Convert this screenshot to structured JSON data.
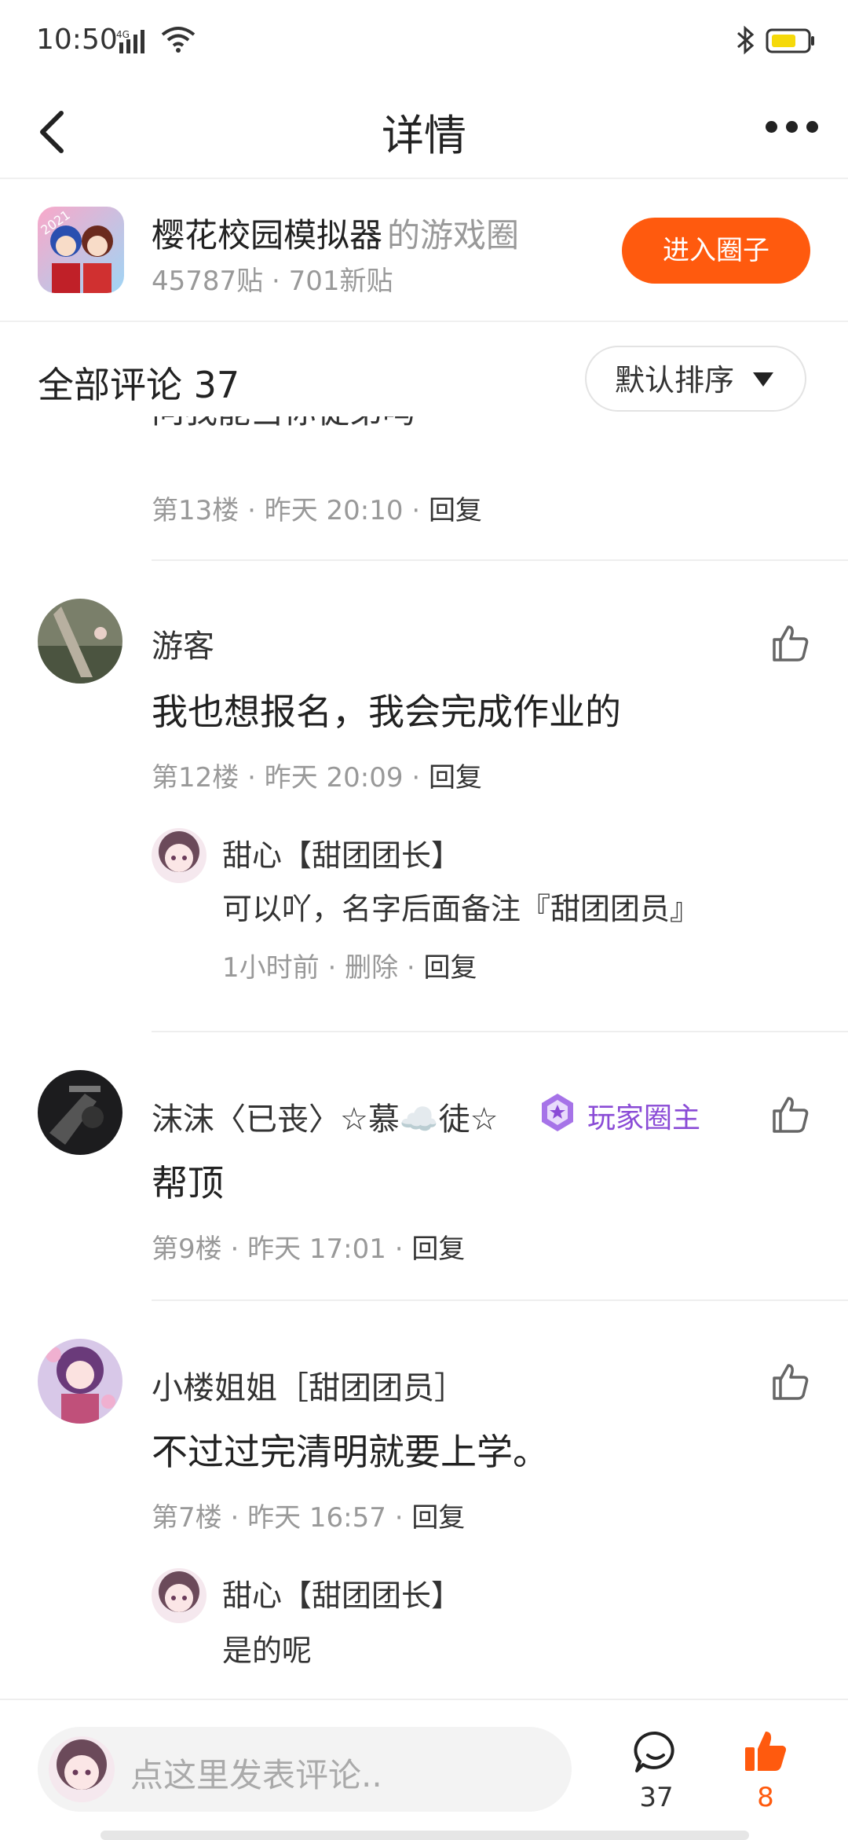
{
  "status_bar": {
    "time": "10:50",
    "network": "4G"
  },
  "header": {
    "title": "详情"
  },
  "circle": {
    "game_name": "樱花校园模拟器",
    "suffix": "的游戏圈",
    "stats": "45787贴 · 701新贴",
    "enter_label": "进入圈子",
    "icon_badge": "2021"
  },
  "comments_header": {
    "title": "全部评论 37",
    "sort_label": "默认排序"
  },
  "partial_comment": {
    "text": "问我能当你徒弟吗",
    "floor": "第13楼",
    "time": "昨天 20:10",
    "reply": "回复"
  },
  "comments": [
    {
      "user": "游客",
      "text": "我也想报名，我会完成作业的",
      "floor": "第12楼",
      "time": "昨天 20:09",
      "reply": "回复",
      "sub": {
        "user": "甜心【甜团团长】",
        "text": "可以吖，名字后面备注『甜团团员』",
        "time": "1小时前",
        "delete": "删除",
        "reply": "回复"
      }
    },
    {
      "user": "沫沫〈已丧〉☆慕☁️徒☆",
      "badge": "玩家圈主",
      "text": "帮顶",
      "floor": "第9楼",
      "time": "昨天 17:01",
      "reply": "回复"
    },
    {
      "user": "小楼姐姐［甜团团员］",
      "text": "不过过完清明就要上学。",
      "floor": "第7楼",
      "time": "昨天 16:57",
      "reply": "回复",
      "sub": {
        "user": "甜心【甜团团长】",
        "text": "是的呢"
      }
    }
  ],
  "bottom_bar": {
    "placeholder": "点这里发表评论..",
    "comment_count": "37",
    "like_count": "8"
  },
  "colors": {
    "accent": "#ff5a0e",
    "badge": "#8a4bd6"
  },
  "icons": [
    "back-icon",
    "more-icon",
    "thumb-up-icon",
    "comment-icon",
    "sort-triangle-icon",
    "bluetooth-icon",
    "battery-icon",
    "wifi-icon",
    "signal-icon"
  ]
}
